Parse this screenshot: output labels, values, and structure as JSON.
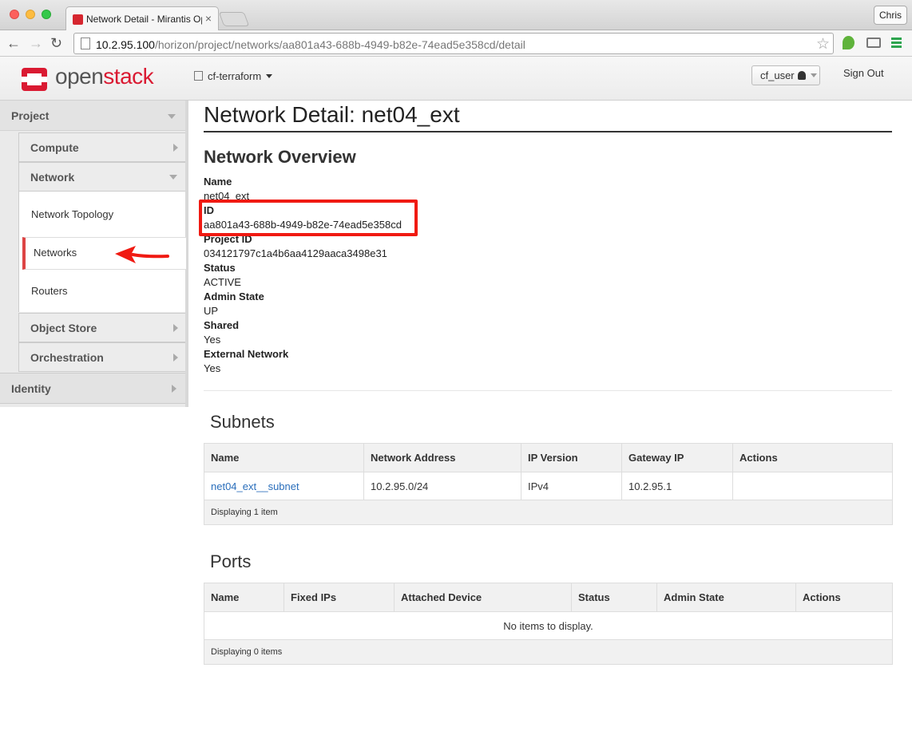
{
  "browser": {
    "tab_title": "Network Detail - Mirantis OpenStack",
    "tab_close": "×",
    "profile": "Chris",
    "url_host": "10.2.95.100",
    "url_path": "/horizon/project/networks/aa801a43-688b-4949-b82e-74ead5e358cd/detail",
    "back_glyph": "←",
    "forward_glyph": "→",
    "reload_glyph": "↻",
    "star_glyph": "☆"
  },
  "header": {
    "logo_open": "open",
    "logo_stack": "stack",
    "project": "cf-terraform",
    "user": "cf_user",
    "sign_out": "Sign Out"
  },
  "sidebar": {
    "project": "Project",
    "compute": "Compute",
    "network": "Network",
    "network_items": [
      "Network Topology",
      "Networks",
      "Routers"
    ],
    "object_store": "Object Store",
    "orchestration": "Orchestration",
    "identity": "Identity"
  },
  "page": {
    "title": "Network Detail: net04_ext",
    "overview_title": "Network Overview",
    "fields": [
      {
        "label": "Name",
        "value": "net04_ext"
      },
      {
        "label": "ID",
        "value": "aa801a43-688b-4949-b82e-74ead5e358cd"
      },
      {
        "label": "Project ID",
        "value": "034121797c1a4b6aa4129aaca3498e31"
      },
      {
        "label": "Status",
        "value": "ACTIVE"
      },
      {
        "label": "Admin State",
        "value": "UP"
      },
      {
        "label": "Shared",
        "value": "Yes"
      },
      {
        "label": "External Network",
        "value": "Yes"
      }
    ]
  },
  "subnets": {
    "title": "Subnets",
    "columns": [
      "Name",
      "Network Address",
      "IP Version",
      "Gateway IP",
      "Actions"
    ],
    "rows": [
      {
        "name": "net04_ext__subnet",
        "network_address": "10.2.95.0/24",
        "ip_version": "IPv4",
        "gateway_ip": "10.2.95.1",
        "actions": ""
      }
    ],
    "footer": "Displaying 1 item"
  },
  "ports": {
    "title": "Ports",
    "columns": [
      "Name",
      "Fixed IPs",
      "Attached Device",
      "Status",
      "Admin State",
      "Actions"
    ],
    "empty": "No items to display.",
    "footer": "Displaying 0 items"
  },
  "colors": {
    "brand_red": "#da1a32",
    "highlight_red": "#f01a12",
    "link_blue": "#2a6ebb"
  }
}
